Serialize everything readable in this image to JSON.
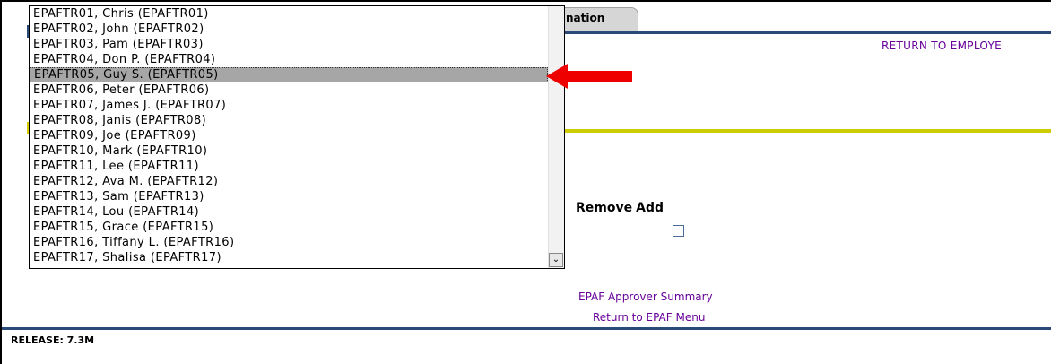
{
  "tab": {
    "label": "nation"
  },
  "links": {
    "return_employee": "RETURN TO EMPLOYE",
    "approver_summary": "EPAF Approver Summary",
    "return_menu": "Return to EPAF Menu"
  },
  "table": {
    "remove_header": "Remove",
    "add_header": "Add"
  },
  "footer": {
    "release": "RELEASE: 7.3M"
  },
  "dropdown": {
    "selected_index": 4,
    "options": [
      "EPAFTR01, Chris (EPAFTR01)",
      "EPAFTR02, John (EPAFTR02)",
      "EPAFTR03, Pam (EPAFTR03)",
      "EPAFTR04, Don P. (EPAFTR04)",
      "EPAFTR05, Guy S. (EPAFTR05)",
      "EPAFTR06, Peter (EPAFTR06)",
      "EPAFTR07, James J. (EPAFTR07)",
      "EPAFTR08, Janis (EPAFTR08)",
      "EPAFTR09, Joe (EPAFTR09)",
      "EPAFTR10, Mark (EPAFTR10)",
      "EPAFTR11, Lee (EPAFTR11)",
      "EPAFTR12, Ava M. (EPAFTR12)",
      "EPAFTR13, Sam (EPAFTR13)",
      "EPAFTR14, Lou (EPAFTR14)",
      "EPAFTR15, Grace (EPAFTR15)",
      "EPAFTR16, Tiffany L. (EPAFTR16)",
      "EPAFTR17, Shalisa (EPAFTR17)"
    ],
    "scroll_icon": "chevron-down-icon"
  },
  "annotation": {
    "arrow_icon": "red-arrow-icon",
    "color": "#ee0000"
  },
  "colors": {
    "link": "#660099",
    "rule_blue": "#2a4a7a",
    "rule_yellow": "#cccc00",
    "selection": "#a6a6a6"
  }
}
